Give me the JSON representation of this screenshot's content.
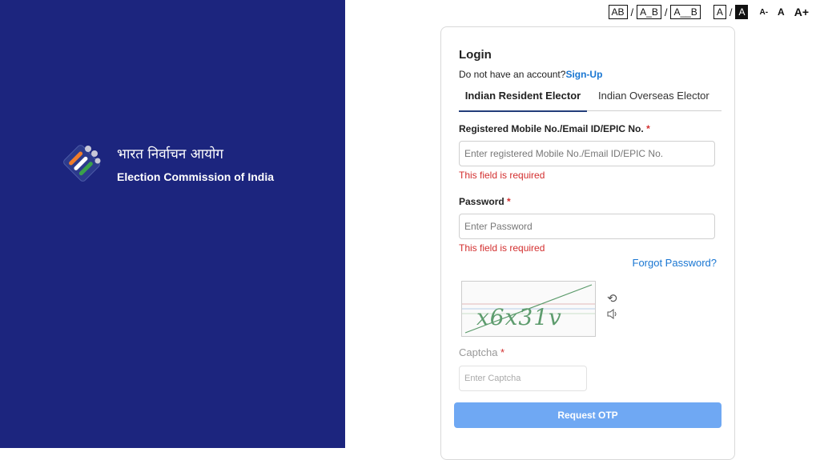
{
  "brand": {
    "hindi": "भारत निर्वाचन आयोग",
    "english": "Election Commission of India"
  },
  "accessibility": {
    "spacing_options": [
      "AB",
      "A_B",
      "A__B"
    ],
    "contrast_options": [
      "A",
      "A"
    ],
    "size_options": [
      "A-",
      "A",
      "A+"
    ],
    "separator": "/"
  },
  "login": {
    "title": "Login",
    "signup_prompt": "Do not have an account?",
    "signup_link": "Sign-Up",
    "tabs": [
      {
        "label": "Indian Resident Elector",
        "active": true
      },
      {
        "label": "Indian Overseas Elector",
        "active": false
      }
    ],
    "id_field": {
      "label": "Registered Mobile No./Email ID/EPIC No.",
      "required_mark": "*",
      "placeholder": "Enter registered Mobile No./Email ID/EPIC No.",
      "value": "",
      "error": "This field is required"
    },
    "password_field": {
      "label": "Password",
      "required_mark": "*",
      "placeholder": "Enter Password",
      "value": "",
      "error": "This field is required"
    },
    "forgot_password": "Forgot Password?",
    "captcha": {
      "image_text": "x6x31v",
      "label": "Captcha",
      "required_mark": "*",
      "placeholder": "Enter Captcha",
      "value": ""
    },
    "submit_button": "Request OTP"
  },
  "colors": {
    "left_panel": "#1c257e",
    "link": "#1976d2",
    "error": "#d32f2f",
    "button": "#6fa8f3"
  }
}
